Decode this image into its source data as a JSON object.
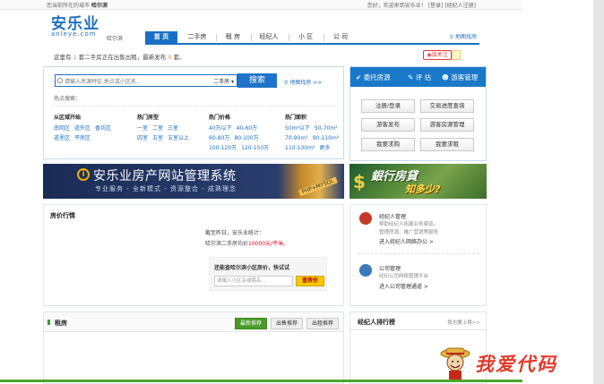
{
  "topbar": {
    "city_prefix": "您当前所在的城市",
    "city": "哈尔滨",
    "welcome": "您好，欢迎来到安乐业！",
    "login": "[登录]",
    "register": "[经纪人注册]"
  },
  "logo": {
    "cn": "安乐业",
    "en": "anleye.com"
  },
  "city_tag": "哈尔滨",
  "nav": {
    "items": [
      "首 页",
      "二手房",
      "租 房",
      "经纪人",
      "小 区",
      "公 司"
    ],
    "map_link": "地图找房"
  },
  "notice": {
    "p1": "这里有",
    "n1": "1",
    "p2": "套二手房正在出售出租，最新发布",
    "n2": "0",
    "p3": "套。"
  },
  "weibo_label": "加关注",
  "search": {
    "placeholder": "请输入房源特征,地点或小区名...",
    "type": "二手房",
    "button": "搜索",
    "map_link": "地图找房 >>",
    "hot": "热点搜索："
  },
  "filters": [
    {
      "title": "从区域开始",
      "rows": [
        [
          "南岗区",
          "道外区",
          "香坊区"
        ],
        [
          "道里区",
          "平房区"
        ]
      ]
    },
    {
      "title": "热门房型",
      "rows": [
        [
          "一室",
          "二室",
          "三室"
        ],
        [
          "四室",
          "五室",
          "五室以上"
        ]
      ]
    },
    {
      "title": "热门价格",
      "rows": [
        [
          "40万以下",
          "40-60万"
        ],
        [
          "60-80万",
          "80-100万"
        ],
        [
          "100-120万",
          "120-150万"
        ]
      ]
    },
    {
      "title": "热门面积",
      "rows": [
        [
          "50m²以下",
          "50-70m²"
        ],
        [
          "70-90m²",
          "90-110m²"
        ],
        [
          "110-130m²",
          "更多"
        ]
      ]
    }
  ],
  "member": {
    "tabs": [
      "委托房源",
      "评 估",
      "游客管理"
    ],
    "buttons": [
      "注册/登录",
      "交易进度查询",
      "游客发布",
      "游客房源管理",
      "我要求购",
      "我要求租"
    ]
  },
  "banner1": {
    "title": "安乐业房产网站管理系统",
    "subtitle": "专业服务 - 全新模式 - 资源整合 - 成熟理念",
    "tag": "PHP+MYSQL"
  },
  "banner2": {
    "t1": "銀行房貸",
    "t2": "知多少?",
    "dollar": "$"
  },
  "price": {
    "title": "房价行情",
    "l1": "截至昨日，安乐业统计：",
    "l2a": "哈尔滨二手房均价",
    "l2b": "10000元/平米",
    "l2c": "。",
    "query_label": "请输入小区房价，快试试",
    "query_prefix": "还能查哈尔滨小区房价，快试试",
    "query_placeholder": "请输入小区名或路名...",
    "query_button": "查房价"
  },
  "agent": {
    "a1_title": "经纪人管理",
    "a1_l1": "帮助经纪人拓展业务渠道。",
    "a1_l2": "管理房源、推广营销等服务",
    "a1_l3": "进入经纪人网络办公 >",
    "a2_title": "公司管理",
    "a2_l1": "经纪公司网络管理平台",
    "a2_l2": "进入公司管理通道 >"
  },
  "rent": {
    "title": "租房",
    "tabs": [
      "最新推荐",
      "出售推荐",
      "出租推荐"
    ]
  },
  "rank": {
    "title": "经纪人排行榜",
    "more": "我也要上榜>>"
  },
  "watermark": "我爱代码",
  "colors": {
    "brand": "#1a70c4",
    "accent_red": "#e2001a",
    "green": "#4aa52e"
  }
}
